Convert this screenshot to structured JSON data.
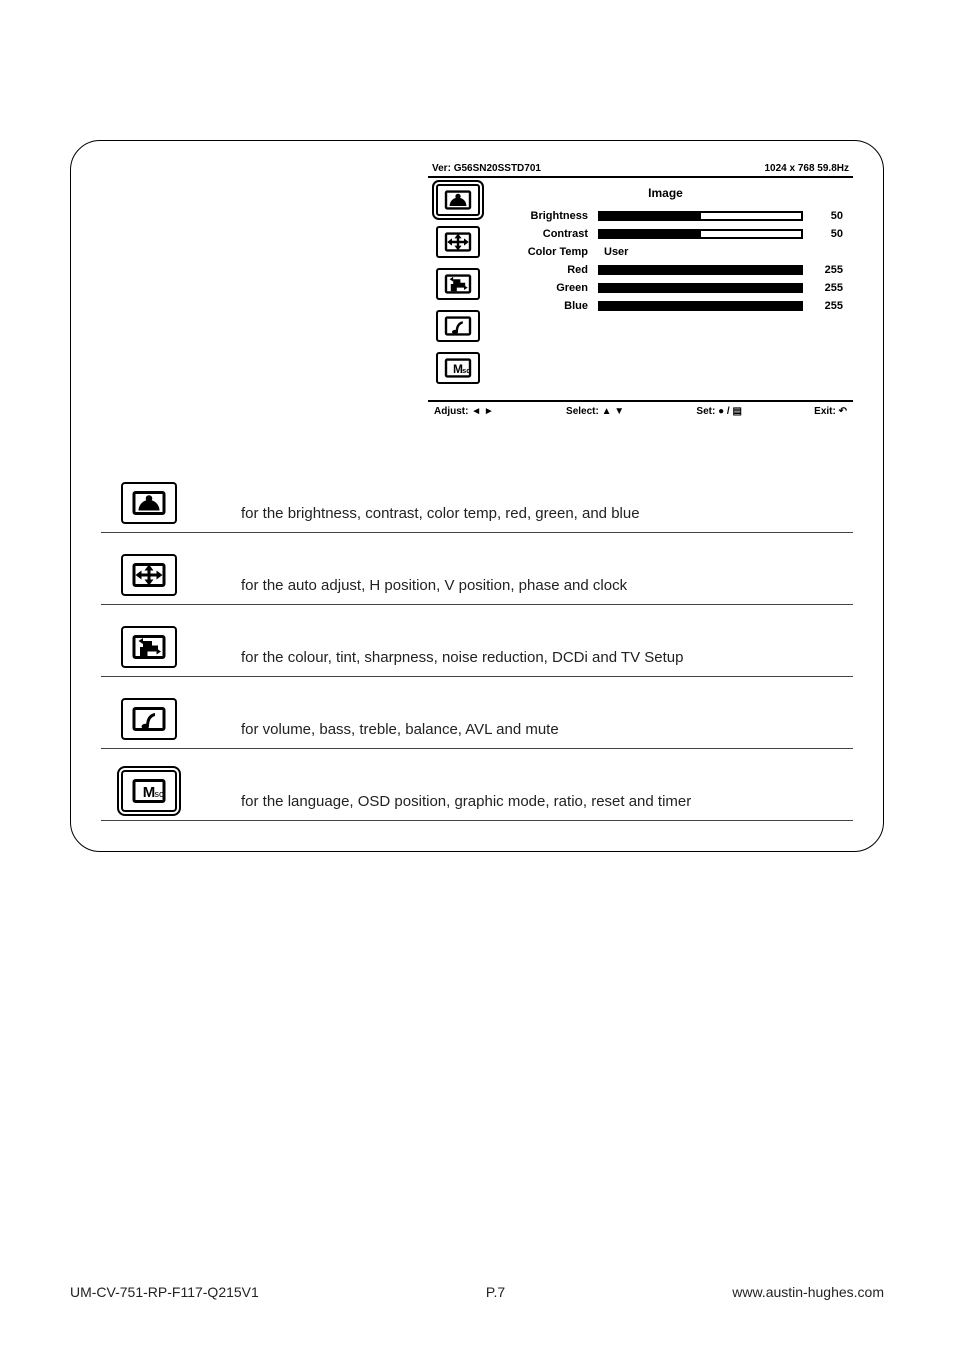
{
  "osd": {
    "version_label": "Ver:",
    "version": "G56SN20SSTD701",
    "resolution": "1024 x 768  59.8Hz",
    "title": "Image",
    "params": [
      {
        "label": "Brightness",
        "value": "50",
        "fill": 50,
        "type": "bar"
      },
      {
        "label": "Contrast",
        "value": "50",
        "fill": 50,
        "type": "bar"
      },
      {
        "label": "Color Temp",
        "text": "User",
        "type": "text"
      },
      {
        "label": "Red",
        "value": "255",
        "fill": 100,
        "type": "bar"
      },
      {
        "label": "Green",
        "value": "255",
        "fill": 100,
        "type": "bar"
      },
      {
        "label": "Blue",
        "value": "255",
        "fill": 100,
        "type": "bar"
      }
    ],
    "footer": {
      "adjust": "Adjust: ◄ ►",
      "select": "Select: ▲ ▼",
      "set": "Set: ● / ▤",
      "exit": "Exit: ↶"
    },
    "side_icons": [
      {
        "name": "image-icon",
        "selected": true
      },
      {
        "name": "position-icon",
        "selected": false
      },
      {
        "name": "color-icon",
        "selected": false
      },
      {
        "name": "audio-icon",
        "selected": false
      },
      {
        "name": "misc-icon",
        "selected": false
      }
    ]
  },
  "legend": [
    {
      "icon": "image-icon",
      "dbl": false,
      "text": "for the brightness, contrast, color temp, red, green, and blue"
    },
    {
      "icon": "position-icon",
      "dbl": false,
      "text": "for the auto adjust, H position, V position, phase and clock"
    },
    {
      "icon": "color-icon",
      "dbl": false,
      "text": "for the colour, tint, sharpness, noise reduction, DCDi and TV Setup"
    },
    {
      "icon": "audio-icon",
      "dbl": false,
      "text": "for volume, bass, treble, balance, AVL and mute"
    },
    {
      "icon": "misc-icon",
      "dbl": true,
      "text": "for the language, OSD position, graphic mode, ratio, reset and timer"
    }
  ],
  "footer": {
    "left": "UM-CV-751-RP-F117-Q215V1",
    "center": "P.7",
    "right": "www.austin-hughes.com"
  }
}
